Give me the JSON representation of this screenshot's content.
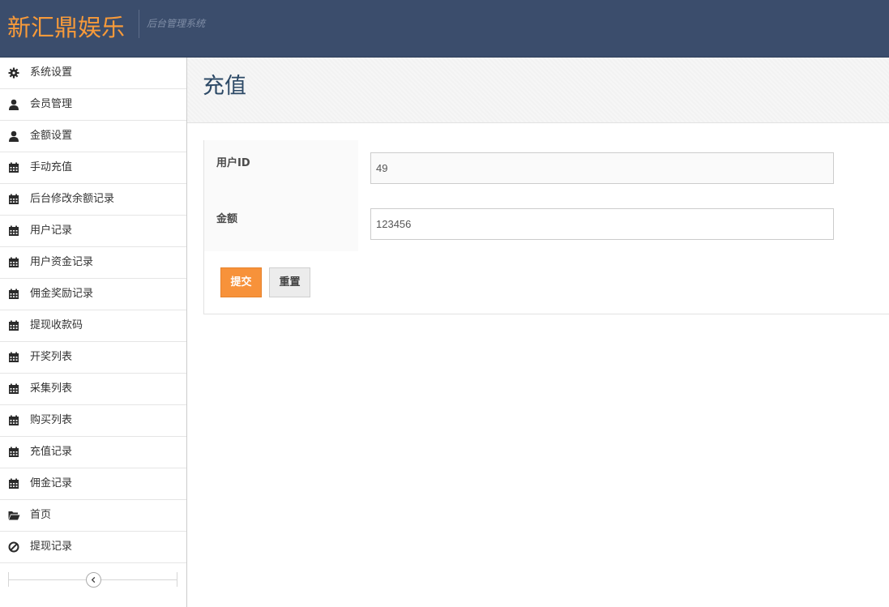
{
  "header": {
    "brand": "新汇鼎娱乐",
    "subtitle": "后台管理系统",
    "bg_color": "#3b4d6c",
    "brand_color": "#f79a3a"
  },
  "sidebar": {
    "items": [
      {
        "label": "系统设置",
        "icon": "gear-icon"
      },
      {
        "label": "会员管理",
        "icon": "user-icon"
      },
      {
        "label": "金额设置",
        "icon": "user-icon"
      },
      {
        "label": "手动充值",
        "icon": "calendar-icon"
      },
      {
        "label": "后台修改余额记录",
        "icon": "calendar-icon"
      },
      {
        "label": "用户记录",
        "icon": "calendar-icon"
      },
      {
        "label": "用户资金记录",
        "icon": "calendar-icon"
      },
      {
        "label": "佣金奖励记录",
        "icon": "calendar-icon"
      },
      {
        "label": "提现收款码",
        "icon": "calendar-icon"
      },
      {
        "label": "开奖列表",
        "icon": "calendar-icon"
      },
      {
        "label": "采集列表",
        "icon": "calendar-icon"
      },
      {
        "label": "购买列表",
        "icon": "calendar-icon"
      },
      {
        "label": "充值记录",
        "icon": "calendar-icon"
      },
      {
        "label": "佣金记录",
        "icon": "calendar-icon"
      },
      {
        "label": "首页",
        "icon": "folder-open-icon"
      },
      {
        "label": "提现记录",
        "icon": "ban-icon"
      }
    ],
    "collapse_icon": "chevron-left-icon"
  },
  "main": {
    "title": "充值",
    "form": {
      "user_id_label": "用户ID",
      "user_id_value": "49",
      "amount_label": "金额",
      "amount_value": "123456",
      "submit_label": "提交",
      "reset_label": "重置"
    },
    "accent_color": "#f7923a"
  }
}
